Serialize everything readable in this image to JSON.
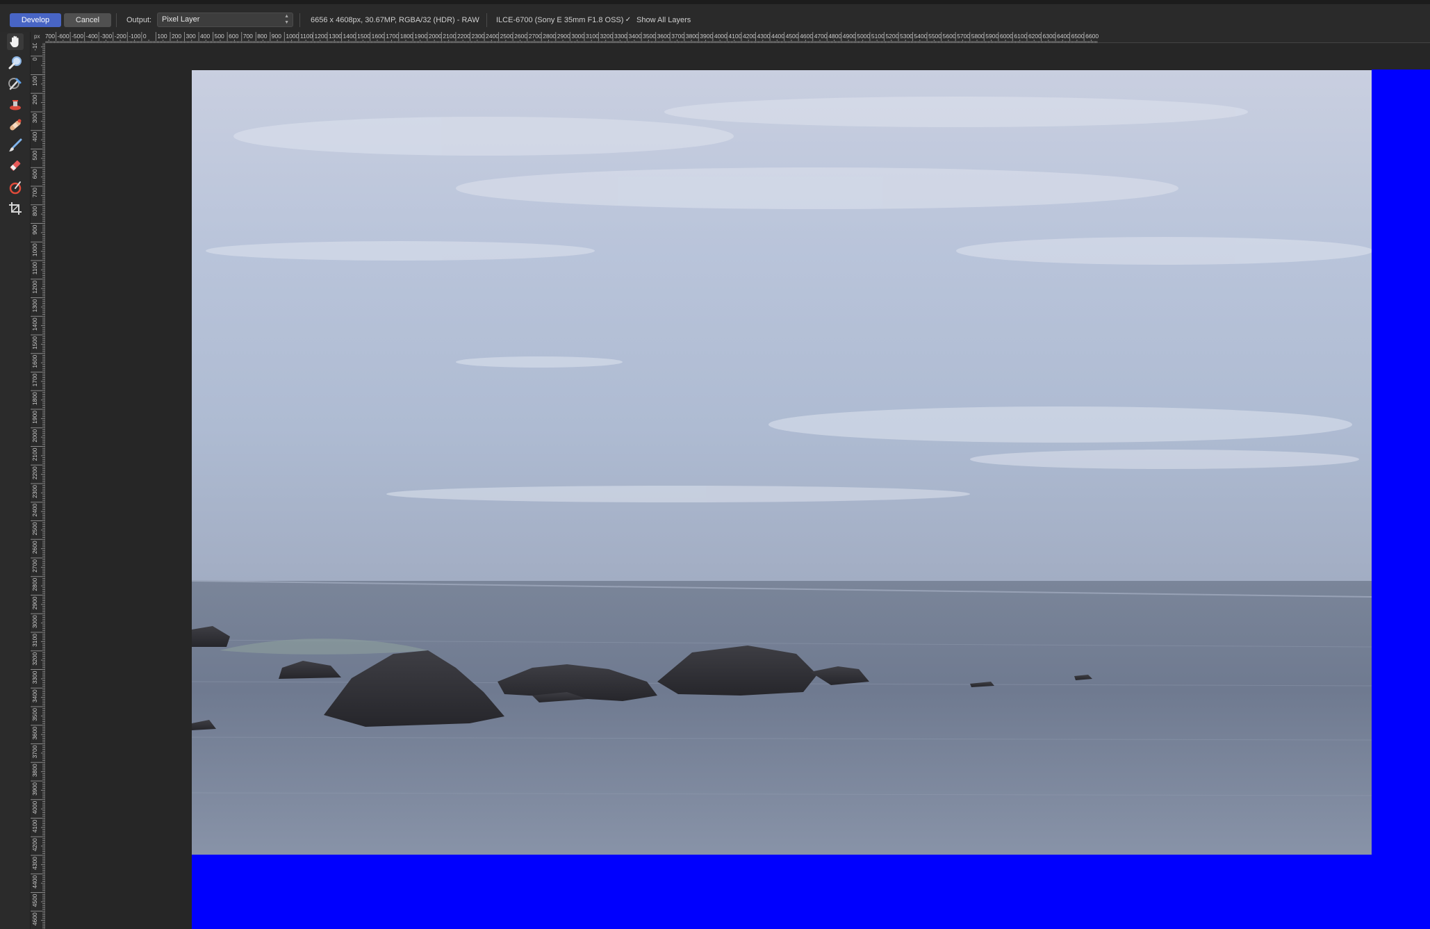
{
  "topbar": {
    "develop_label": "Develop",
    "cancel_label": "Cancel",
    "output_label": "Output:",
    "output_value": "Pixel Layer",
    "image_info": "6656 x 4608px, 30.67MP, RGBA/32 (HDR) - RAW",
    "camera_info": "ILCE-6700 (Sony E 35mm F1.8 OSS)",
    "show_all_layers_label": "Show All Layers",
    "show_all_layers_checked": true
  },
  "tools": [
    {
      "name": "hand-tool",
      "icon": "hand-icon",
      "active": true
    },
    {
      "name": "zoom-tool",
      "icon": "magnifier-icon"
    },
    {
      "name": "white-balance-tool",
      "icon": "eyedropper-icon"
    },
    {
      "name": "red-eye-tool",
      "icon": "red-eye-icon"
    },
    {
      "name": "blemish-removal-tool",
      "icon": "bandage-icon"
    },
    {
      "name": "overlay-paint-tool",
      "icon": "brush-icon"
    },
    {
      "name": "overlay-erase-tool",
      "icon": "eraser-icon"
    },
    {
      "name": "overlay-gradient-tool",
      "icon": "gradient-icon"
    },
    {
      "name": "crop-tool",
      "icon": "crop-icon"
    }
  ],
  "rulers": {
    "unit": "px",
    "horizontal_labels": [
      "-700",
      "-600",
      "-500",
      "-400",
      "-300",
      "-200",
      "-100",
      "0",
      "100",
      "200",
      "300",
      "400",
      "500",
      "600",
      "700",
      "800",
      "900",
      "1000",
      "1100",
      "1200",
      "1300",
      "1400",
      "1500",
      "1600",
      "1700",
      "1800",
      "1900",
      "2000",
      "2100",
      "2200",
      "2300",
      "2400",
      "2500",
      "2600",
      "2700",
      "2800",
      "2900",
      "3000",
      "3100",
      "3200",
      "3300",
      "3400",
      "3500",
      "3600",
      "3700",
      "3800",
      "3900",
      "4000",
      "4100",
      "4200",
      "4300",
      "4400",
      "4500",
      "4600",
      "4700",
      "4800",
      "4900",
      "5000",
      "5100",
      "5200",
      "5300",
      "5400",
      "5500",
      "5600",
      "5700",
      "5800",
      "5900",
      "6000",
      "6100",
      "6200",
      "6300",
      "6400",
      "6500",
      "6600"
    ],
    "vertical_labels": [
      "-100",
      "0",
      "100",
      "200",
      "300",
      "400",
      "500",
      "600",
      "700",
      "800",
      "900",
      "1000",
      "1100",
      "1200",
      "1300",
      "1400",
      "1500",
      "1600",
      "1700",
      "1800",
      "1900",
      "2000",
      "2100",
      "2200",
      "2300",
      "2400",
      "2500",
      "2600",
      "2700",
      "2800",
      "2900",
      "3000",
      "3100",
      "3200",
      "3300",
      "3400",
      "3500",
      "3600",
      "3700",
      "3800",
      "3900",
      "4000",
      "4100",
      "4200",
      "4300",
      "4400",
      "4500",
      "4600"
    ]
  },
  "colors": {
    "accent": "#4865c5",
    "overflow_blue": "#0000fe"
  }
}
